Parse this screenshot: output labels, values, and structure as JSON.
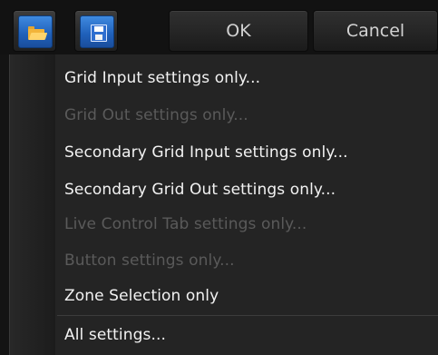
{
  "toolbar": {
    "open_icon": "folder-open-icon",
    "save_icon": "save-disk-icon",
    "ok_label": "OK",
    "cancel_label": "Cancel"
  },
  "menu": {
    "items": [
      {
        "label": "Grid Input settings only...",
        "enabled": true
      },
      {
        "label": "Grid Out settings only...",
        "enabled": false
      },
      {
        "label": "Secondary Grid Input settings only...",
        "enabled": true
      },
      {
        "label": "Secondary Grid Out settings only...",
        "enabled": true
      },
      {
        "label": "Live Control Tab settings only...",
        "enabled": false
      },
      {
        "label": "Button settings only...",
        "enabled": false
      },
      {
        "label": "Zone Selection only",
        "enabled": true
      },
      {
        "label": "All settings...",
        "enabled": true
      }
    ]
  },
  "colors": {
    "enabled_text": "#f2f2f2",
    "disabled_text": "#5a5a5a",
    "accent_blue": "#2f72d6",
    "folder_yellow": "#f2b43a"
  }
}
